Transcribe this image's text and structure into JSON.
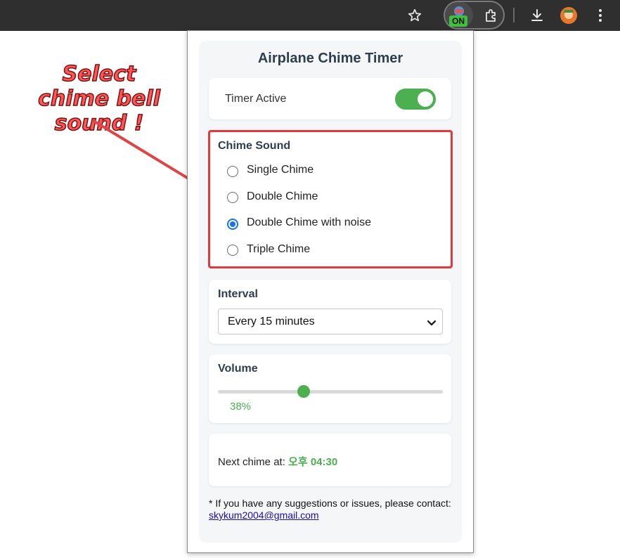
{
  "browser": {
    "ext_badge": "ON",
    "icons": [
      "star-icon",
      "extension-icon",
      "puzzle-icon",
      "download-icon",
      "avatar-icon",
      "more-menu-icon"
    ]
  },
  "annotation": {
    "text": "Select chime bell sound !"
  },
  "popup": {
    "title": "Airplane Chime Timer",
    "timer": {
      "label": "Timer Active",
      "on": true
    },
    "chime": {
      "heading": "Chime Sound",
      "options": [
        "Single Chime",
        "Double Chime",
        "Double Chime with noise",
        "Triple Chime"
      ],
      "selected": "Double Chime with noise"
    },
    "interval": {
      "heading": "Interval",
      "value": "Every 15 minutes"
    },
    "volume": {
      "heading": "Volume",
      "value": "38%",
      "level": 0.38
    },
    "next": {
      "label": "Next chime at:",
      "time": "오후 04:30"
    },
    "footer": {
      "text": "* If you have any suggestions or issues, please contact:",
      "email": "skykum2004@gmail.com"
    }
  },
  "colors": {
    "accent_green": "#4caf50",
    "radio_blue": "#1a73e8",
    "highlight_red": "#e0393e",
    "annotation_red": "#ff5757"
  }
}
